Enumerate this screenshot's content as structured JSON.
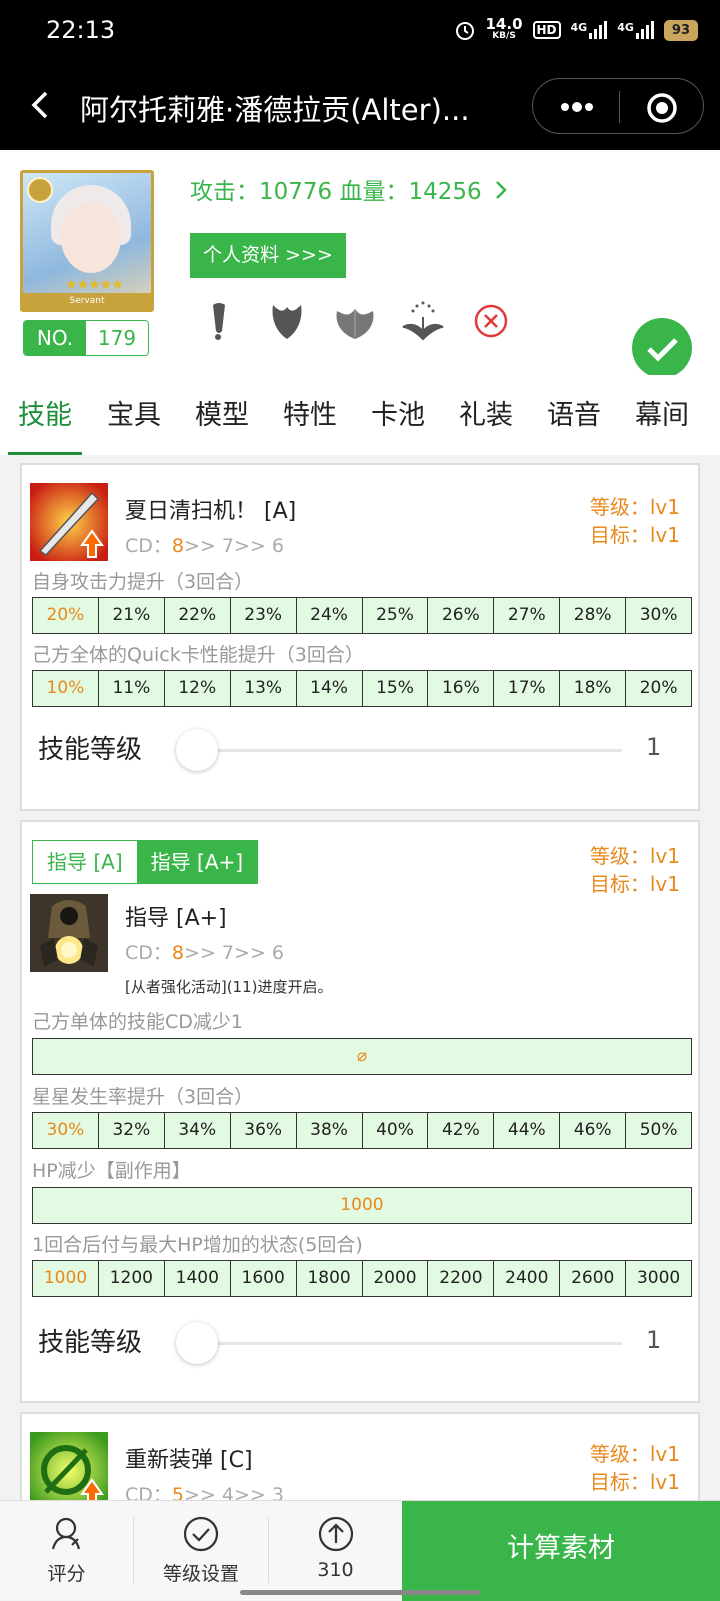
{
  "status": {
    "time": "22:13",
    "speed": "14.0",
    "speed_unit": "KB/S",
    "hd": "HD",
    "net1": "4G",
    "net2": "4G",
    "battery": "93"
  },
  "header": {
    "title": "阿尔托莉雅·潘德拉贡(Alter)..."
  },
  "hero": {
    "stats": "攻击：10776  血量：14256",
    "profile_button": "个人资料 >>>",
    "no_label": "NO.",
    "no_value": "179",
    "stars": "★★★★★",
    "servant_banner": "Servant"
  },
  "tabs": [
    "技能",
    "宝具",
    "模型",
    "特性",
    "卡池",
    "礼装",
    "语音",
    "幕间"
  ],
  "skill1": {
    "name": "夏日清扫机！ [A]",
    "cd_label": "CD：",
    "cd_current": "8",
    "cd_rest": ">> 7>> 6",
    "level_label": "等级：lv1",
    "target_label": "目标：lv1",
    "effects": [
      {
        "text": "自身攻击力提升（3回合）",
        "values": [
          "20%",
          "21%",
          "22%",
          "23%",
          "24%",
          "25%",
          "26%",
          "27%",
          "28%",
          "30%"
        ]
      },
      {
        "text": "己方全体的Quick卡性能提升（3回合）",
        "values": [
          "10%",
          "11%",
          "12%",
          "13%",
          "14%",
          "15%",
          "16%",
          "17%",
          "18%",
          "20%"
        ]
      }
    ],
    "slider_label": "技能等级",
    "slider_value": "1",
    "slider_level": 1
  },
  "skill2": {
    "toggle": [
      "指导 [A]",
      "指导 [A+]"
    ],
    "name": "指导 [A+]",
    "cd_label": "CD：",
    "cd_current": "8",
    "cd_rest": ">> 7>> 6",
    "note": "[从者强化活动](11)进度开启。",
    "level_label": "等级：lv1",
    "target_label": "目标：lv1",
    "effects": [
      {
        "text": "己方单体的技能CD减少1",
        "full": "⌀"
      },
      {
        "text": "星星发生率提升（3回合）",
        "values": [
          "30%",
          "32%",
          "34%",
          "36%",
          "38%",
          "40%",
          "42%",
          "44%",
          "46%",
          "50%"
        ]
      },
      {
        "text": "HP减少【副作用】",
        "full": "1000"
      },
      {
        "text": "1回合后付与最大HP增加的状态(5回合)",
        "values": [
          "1000",
          "1200",
          "1400",
          "1600",
          "1800",
          "2000",
          "2200",
          "2400",
          "2600",
          "3000"
        ]
      }
    ],
    "slider_label": "技能等级",
    "slider_value": "1",
    "slider_level": 1
  },
  "skill3": {
    "name": "重新装弹 [C]",
    "cd_label": "CD：",
    "cd_current": "5",
    "cd_rest": ">> 4>> 3",
    "level_label": "等级：lv1",
    "target_label": "目标：lv1"
  },
  "bottombar": {
    "rate": "评分",
    "level_setting": "等级设置",
    "count": "310",
    "calc": "计算素材"
  },
  "colors": {
    "accent": "#3ab54a",
    "orange": "#e8891d",
    "cell_bg": "#e2f9e2"
  }
}
